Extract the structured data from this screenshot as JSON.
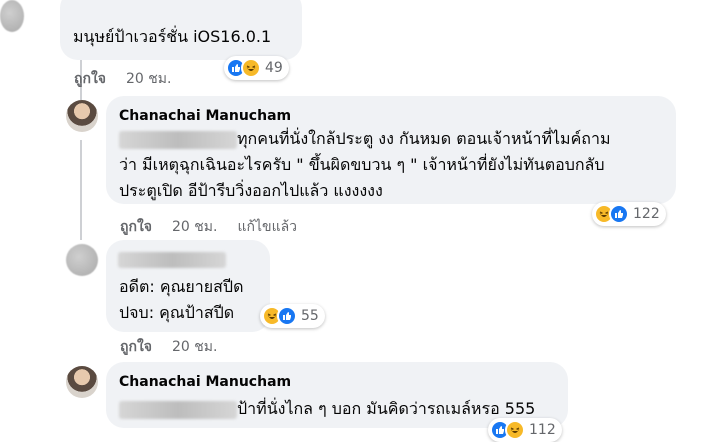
{
  "comments": [
    {
      "text": "มนุษย์ป้าเวอร์ชั่น iOS16.0.1",
      "like_label": "ถูกใจ",
      "time": "20 ชม.",
      "reaction_count": "49"
    },
    {
      "author": "Chanachai Manucham",
      "line1": "ทุกคนที่นั่งใกล้ประตู งง กันหมด ตอนเจ้าหน้าที่ไมค์ถาม",
      "line2": "ว่า มีเหตุฉุกเฉินอะไรครับ \" ขึ้นผิดขบวน ๆ \" เจ้าหน้าที่ยังไม่ทันตอบกลับ",
      "line3": "ประตูเปิด อีป้ารีบวิ่งออกไปแล้ว แงงงงง",
      "like_label": "ถูกใจ",
      "time": "20 ชม.",
      "edited": "แก้ไขแล้ว",
      "reaction_count": "122"
    },
    {
      "line1": "อดีต: คุณยายสปีด",
      "line2": "ปจบ: คุณป้าสปีด",
      "like_label": "ถูกใจ",
      "time": "20 ชม.",
      "reaction_count": "55"
    },
    {
      "author": "Chanachai Manucham",
      "text": "ป้าที่นั่งไกล ๆ บอก มันคิดว่ารถเมล์หรอ 555",
      "reaction_count": "112"
    }
  ]
}
